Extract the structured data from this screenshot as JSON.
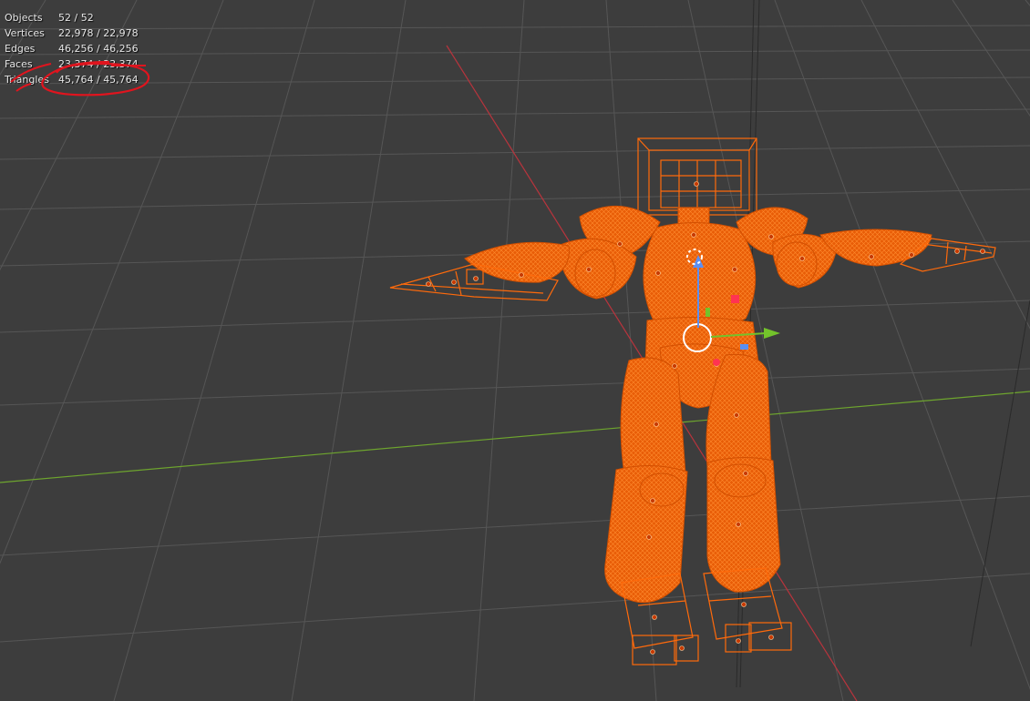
{
  "overlay": {
    "stats": [
      {
        "label": "Objects",
        "value": "52 / 52"
      },
      {
        "label": "Vertices",
        "value": "22,978 / 22,978"
      },
      {
        "label": "Edges",
        "value": "46,256 / 46,256"
      },
      {
        "label": "Faces",
        "value": "23,374 / 23,374"
      },
      {
        "label": "Triangles",
        "value": "45,764 / 45,764"
      }
    ]
  },
  "viewport": {
    "background": "#3d3d3d",
    "grid_color": "#555555",
    "x_axis_color": "#b8343d",
    "y_axis_color": "#6ea52e",
    "selection_color": "#ff6a0b",
    "gizmo": {
      "x": "#73c32b",
      "y": "#ff3352",
      "z": "#5b8ff2"
    },
    "annotation_color": "#e0141e"
  }
}
